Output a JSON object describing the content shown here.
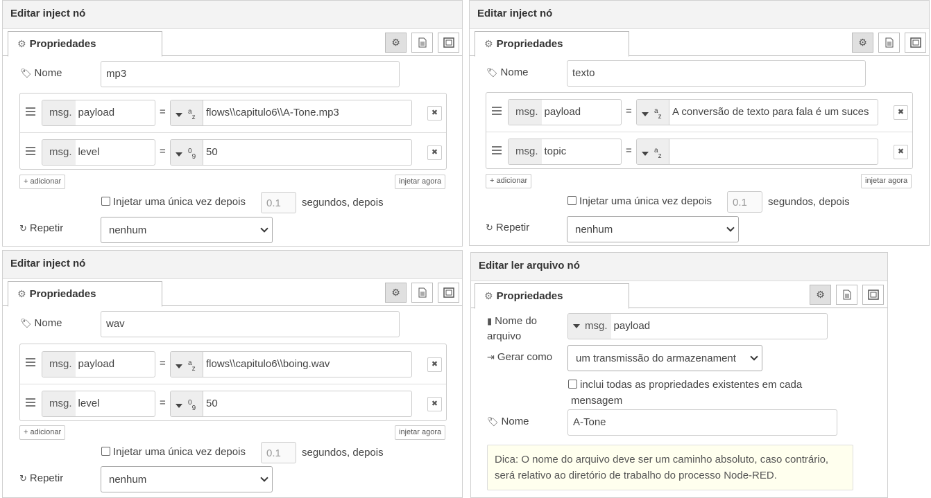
{
  "panels": {
    "p1": {
      "title": "Editar inject nó",
      "tab": "Propriedades",
      "name_label": "Nome",
      "name_value": "mp3",
      "rows": [
        {
          "prefix": "msg.",
          "prop": "payload",
          "eq": "=",
          "type_icon": "az",
          "value": "flows\\\\capitulo6\\\\A-Tone.mp3"
        },
        {
          "prefix": "msg.",
          "prop": "level",
          "eq": "=",
          "type_icon": "09",
          "value": "50"
        }
      ],
      "add_label": "adicionar",
      "inject_now_label": "injetar agora",
      "once_label": "Injetar uma única vez depois",
      "once_value": "0.1",
      "seconds_label": "segundos, depois",
      "repeat_label": "Repetir",
      "repeat_value": "nenhum"
    },
    "p2": {
      "title": "Editar inject nó",
      "tab": "Propriedades",
      "name_label": "Nome",
      "name_value": "texto",
      "rows": [
        {
          "prefix": "msg.",
          "prop": "payload",
          "eq": "=",
          "type_icon": "az",
          "value": "A conversão de texto para fala é um suces"
        },
        {
          "prefix": "msg.",
          "prop": "topic",
          "eq": "=",
          "type_icon": "az",
          "value": ""
        }
      ],
      "add_label": "adicionar",
      "inject_now_label": "injetar agora",
      "once_label": "Injetar uma única vez depois",
      "once_value": "0.1",
      "seconds_label": "segundos, depois",
      "repeat_label": "Repetir",
      "repeat_value": "nenhum"
    },
    "p3": {
      "title": "Editar inject nó",
      "tab": "Propriedades",
      "name_label": "Nome",
      "name_value": "wav",
      "rows": [
        {
          "prefix": "msg.",
          "prop": "payload",
          "eq": "=",
          "type_icon": "az",
          "value": "flows\\\\capitulo6\\\\boing.wav"
        },
        {
          "prefix": "msg.",
          "prop": "level",
          "eq": "=",
          "type_icon": "09",
          "value": "50"
        }
      ],
      "add_label": "adicionar",
      "inject_now_label": "injetar agora",
      "once_label": "Injetar uma única vez depois",
      "once_value": "0.1",
      "seconds_label": "segundos, depois",
      "repeat_label": "Repetir",
      "repeat_value": "nenhum"
    },
    "p4": {
      "title": "Editar ler arquivo nó",
      "tab": "Propriedades",
      "filename_label_1": "Nome do",
      "filename_label_2": "arquivo",
      "filename_prefix": "msg.",
      "filename_value": "payload",
      "output_label": "Gerar como",
      "output_value": "um transmissão do armazenament",
      "include_label_1": "inclui todas as propriedades existentes em cada",
      "include_label_2": "mensagem",
      "name_label": "Nome",
      "name_value": "A-Tone",
      "tip_line1": "Dica: O nome do arquivo deve ser um caminho absoluto, caso contrário,",
      "tip_line2": "será relativo ao diretório de trabalho do processo Node-RED."
    }
  },
  "icons": [
    "gear-icon",
    "document-icon",
    "frame-icon",
    "tag-icon",
    "file-icon",
    "sign-out-icon",
    "refresh-icon",
    "drag-handle-icon",
    "close-icon",
    "plus-icon"
  ],
  "colors": {
    "header_bg": "#f3f3f3",
    "tip_bg": "#ffffee",
    "border": "#cccccc",
    "selected_btn": "#e0e0e0"
  }
}
